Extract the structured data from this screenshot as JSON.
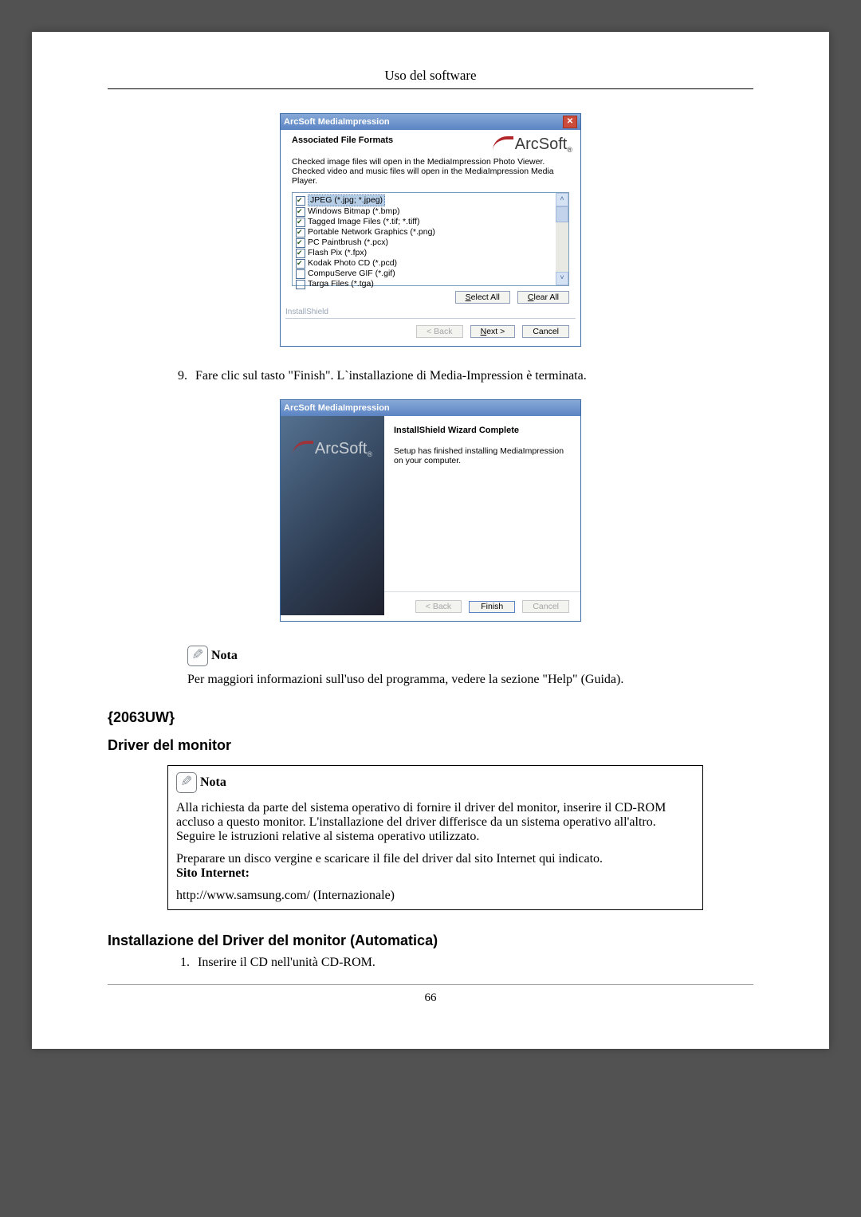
{
  "header": {
    "title": "Uso del software"
  },
  "dialog1": {
    "title": "ArcSoft MediaImpression",
    "heading": "Associated File Formats",
    "instruction": "Checked image files will open in the MediaImpression Photo Viewer. Checked video and music files will open in the MediaImpression Media Player.",
    "formats": [
      {
        "label": "JPEG (*.jpg; *.jpeg)",
        "checked": true,
        "selected": true
      },
      {
        "label": "Windows Bitmap (*.bmp)",
        "checked": true
      },
      {
        "label": "Tagged Image Files (*.tif; *.tiff)",
        "checked": true
      },
      {
        "label": "Portable Network Graphics (*.png)",
        "checked": true
      },
      {
        "label": "PC Paintbrush (*.pcx)",
        "checked": true
      },
      {
        "label": "Flash Pix (*.fpx)",
        "checked": true
      },
      {
        "label": "Kodak Photo CD (*.pcd)",
        "checked": true
      },
      {
        "label": "CompuServe GIF (*.gif)",
        "checked": false
      },
      {
        "label": "Targa Files (*.tga)",
        "checked": false
      }
    ],
    "select_all": "Select All",
    "clear_all": "Clear All",
    "installshield": "InstallShield",
    "back": "< Back",
    "next": "Next >",
    "cancel": "Cancel"
  },
  "step9": {
    "num": "9.",
    "text": "Fare clic sul tasto \"Finish\". L`installazione di Media-Impression è terminata."
  },
  "dialog2": {
    "title": "ArcSoft MediaImpression",
    "complete_title": "InstallShield Wizard Complete",
    "complete_text": "Setup has finished installing MediaImpression on your computer.",
    "back": "< Back",
    "finish": "Finish",
    "cancel": "Cancel",
    "brand": "ArcSoft"
  },
  "arcsoft_brand": "ArcSoft",
  "nota_small": {
    "label": "Nota",
    "text": "Per maggiori informazioni sull'uso del programma, vedere la sezione \"Help\" (Guida)."
  },
  "sections": {
    "model": "{2063UW}",
    "driver": "Driver del monitor",
    "auto_install": "Installazione del Driver del monitor (Automatica)"
  },
  "nota_box": {
    "label": "Nota",
    "p1": "Alla richiesta da parte del sistema operativo di fornire il driver del monitor, inserire il CD-ROM accluso a questo monitor. L'installazione del driver differisce da un sistema operativo all'altro. Seguire le istruzioni relative al sistema operativo utilizzato.",
    "p2": "Preparare un disco vergine e scaricare il file del driver dal sito Internet qui indicato.",
    "sito_label": "Sito Internet:",
    "link": "http://www.samsung.com/ (Internazionale)"
  },
  "install_step1": {
    "num": "1.",
    "text": "Inserire il CD nell'unità CD-ROM."
  },
  "page_number": "66"
}
